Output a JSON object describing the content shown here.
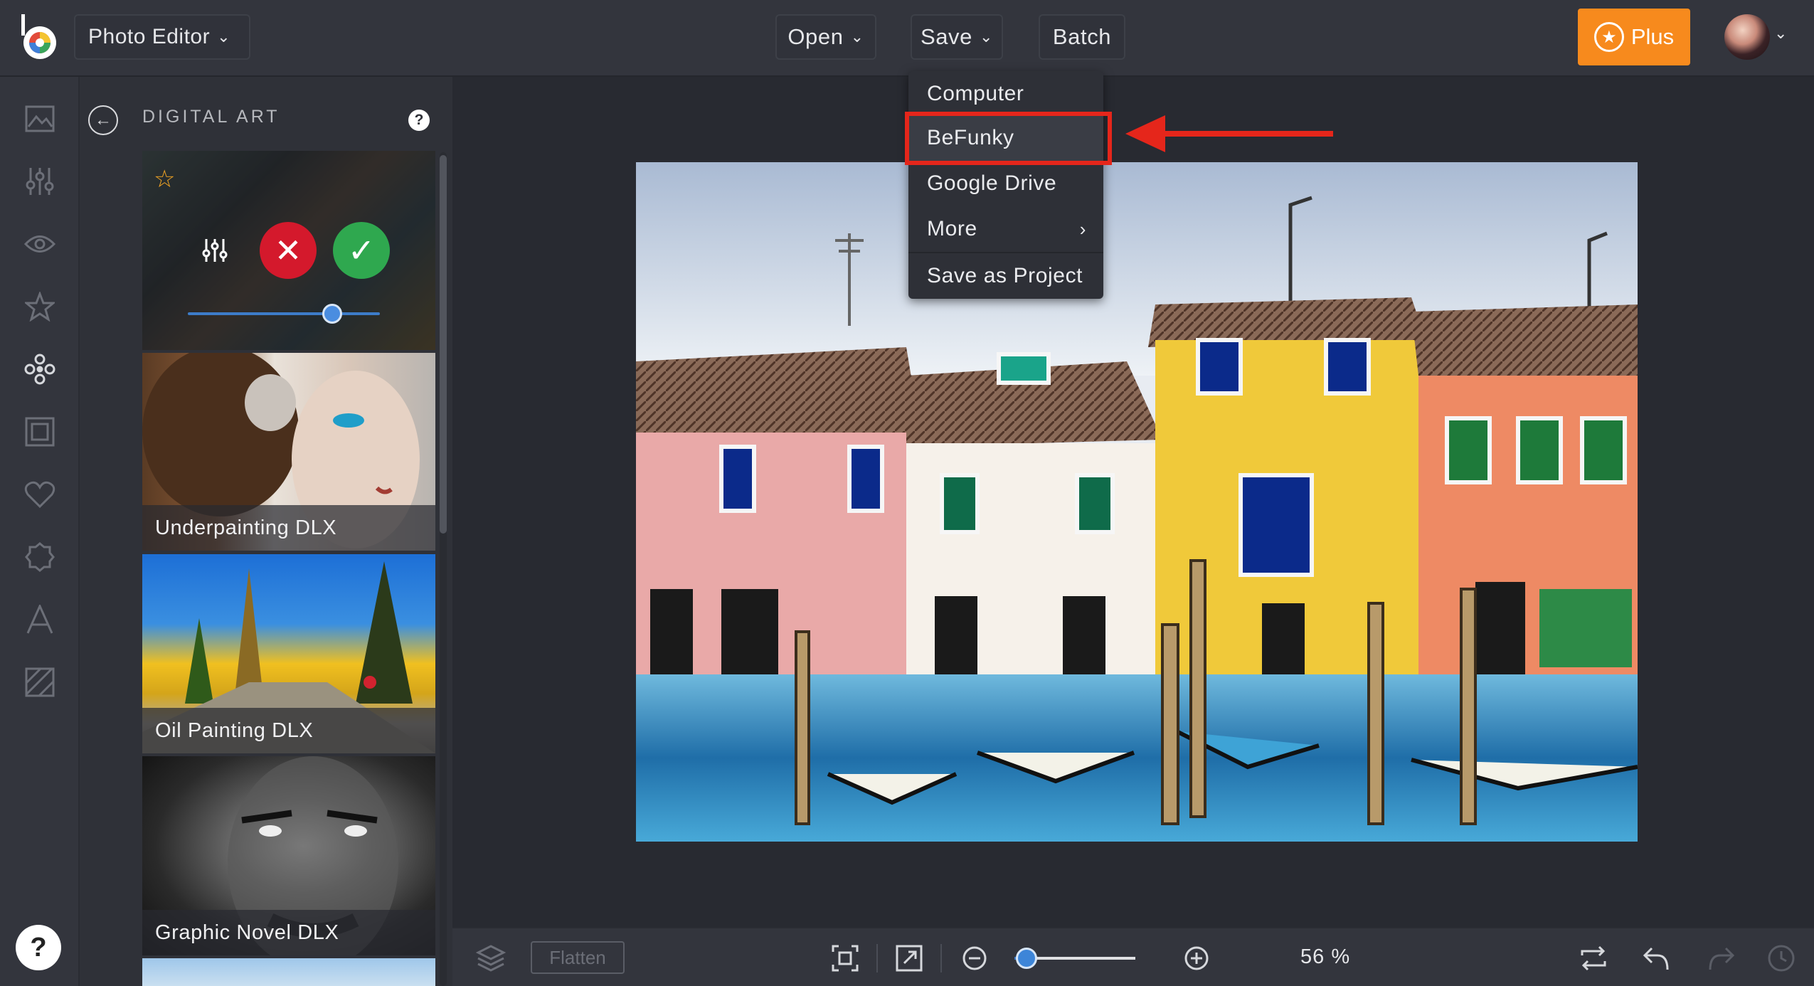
{
  "header": {
    "app_selector_label": "Photo Editor",
    "open_label": "Open",
    "save_label": "Save",
    "batch_label": "Batch",
    "plus_label": "Plus"
  },
  "save_menu": {
    "items": [
      {
        "label": "Computer"
      },
      {
        "label": "BeFunky"
      },
      {
        "label": "Google Drive"
      },
      {
        "label": "More",
        "arrow": "›"
      },
      {
        "label": "Save as Project"
      }
    ],
    "highlighted_item": "BeFunky"
  },
  "panel": {
    "title": "DIGITAL ART",
    "intensity_fraction": 0.75,
    "effects": [
      {
        "label": "Underpainting DLX"
      },
      {
        "label": "Oil Painting DLX"
      },
      {
        "label": "Graphic Novel DLX"
      }
    ]
  },
  "toolrail": {
    "icons": [
      "image-icon",
      "sliders-icon",
      "eye-icon",
      "star-icon",
      "effects-icon",
      "frame-icon",
      "heart-icon",
      "badge-icon",
      "text-icon",
      "texture-icon"
    ],
    "help_label": "?"
  },
  "bottombar": {
    "flatten_label": "Flatten",
    "zoom_value": "56 %",
    "zoom_percent": 56
  },
  "colors": {
    "accent_orange": "#f78a1d",
    "annotation_red": "#e5261b",
    "cancel_red": "#d4192c",
    "confirm_green": "#2fa84f",
    "slider_blue": "#3d7cc9"
  }
}
